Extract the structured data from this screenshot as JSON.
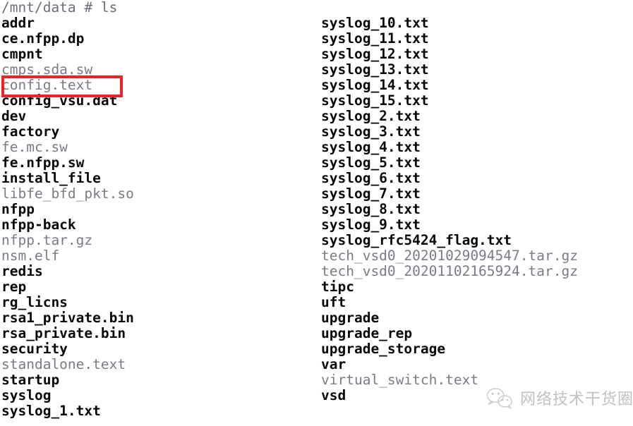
{
  "terminal": {
    "prompt_line": "/mnt/data # ls",
    "left_column": [
      {
        "name": "addr",
        "type": "dir"
      },
      {
        "name": "ce.nfpp.dp",
        "type": "dir"
      },
      {
        "name": "cmpnt",
        "type": "dir"
      },
      {
        "name": "cmps.sda.sw",
        "type": "file"
      },
      {
        "name": "config.text",
        "type": "file"
      },
      {
        "name": "config_vsu.dat",
        "type": "dir"
      },
      {
        "name": "dev",
        "type": "dir"
      },
      {
        "name": "factory",
        "type": "dir"
      },
      {
        "name": "fe.mc.sw",
        "type": "file"
      },
      {
        "name": "fe.nfpp.sw",
        "type": "dir"
      },
      {
        "name": "install_file",
        "type": "dir"
      },
      {
        "name": "libfe_bfd_pkt.so",
        "type": "file"
      },
      {
        "name": "nfpp",
        "type": "dir"
      },
      {
        "name": "nfpp-back",
        "type": "dir"
      },
      {
        "name": "nfpp.tar.gz",
        "type": "file"
      },
      {
        "name": "nsm.elf",
        "type": "file"
      },
      {
        "name": "redis",
        "type": "dir"
      },
      {
        "name": "rep",
        "type": "dir"
      },
      {
        "name": "rg_licns",
        "type": "dir"
      },
      {
        "name": "rsa1_private.bin",
        "type": "dir"
      },
      {
        "name": "rsa_private.bin",
        "type": "dir"
      },
      {
        "name": "security",
        "type": "dir"
      },
      {
        "name": "standalone.text",
        "type": "file"
      },
      {
        "name": "startup",
        "type": "dir"
      },
      {
        "name": "syslog",
        "type": "dir"
      },
      {
        "name": "syslog_1.txt",
        "type": "dir"
      }
    ],
    "right_column": [
      {
        "name": "syslog_10.txt",
        "type": "dir"
      },
      {
        "name": "syslog_11.txt",
        "type": "dir"
      },
      {
        "name": "syslog_12.txt",
        "type": "dir"
      },
      {
        "name": "syslog_13.txt",
        "type": "dir"
      },
      {
        "name": "syslog_14.txt",
        "type": "dir"
      },
      {
        "name": "syslog_15.txt",
        "type": "dir"
      },
      {
        "name": "syslog_2.txt",
        "type": "dir"
      },
      {
        "name": "syslog_3.txt",
        "type": "dir"
      },
      {
        "name": "syslog_4.txt",
        "type": "dir"
      },
      {
        "name": "syslog_5.txt",
        "type": "dir"
      },
      {
        "name": "syslog_6.txt",
        "type": "dir"
      },
      {
        "name": "syslog_7.txt",
        "type": "dir"
      },
      {
        "name": "syslog_8.txt",
        "type": "dir"
      },
      {
        "name": "syslog_9.txt",
        "type": "dir"
      },
      {
        "name": "syslog_rfc5424_flag.txt",
        "type": "dir"
      },
      {
        "name": "tech_vsd0_20201029094547.tar.gz",
        "type": "file"
      },
      {
        "name": "tech_vsd0_20201102165924.tar.gz",
        "type": "file"
      },
      {
        "name": "tipc",
        "type": "dir"
      },
      {
        "name": "uft",
        "type": "dir"
      },
      {
        "name": "upgrade",
        "type": "dir"
      },
      {
        "name": "upgrade_rep",
        "type": "dir"
      },
      {
        "name": "upgrade_storage",
        "type": "dir"
      },
      {
        "name": "var",
        "type": "dir"
      },
      {
        "name": "virtual_switch.text",
        "type": "file"
      },
      {
        "name": "vsd",
        "type": "dir"
      }
    ]
  },
  "annotation": {
    "highlighted_entry": "config.text",
    "box_color": "#ee2222"
  },
  "watermark": {
    "text": "网络技术干货圈",
    "logo_icon": "wechat-icon",
    "color": "#a9a9b0"
  }
}
